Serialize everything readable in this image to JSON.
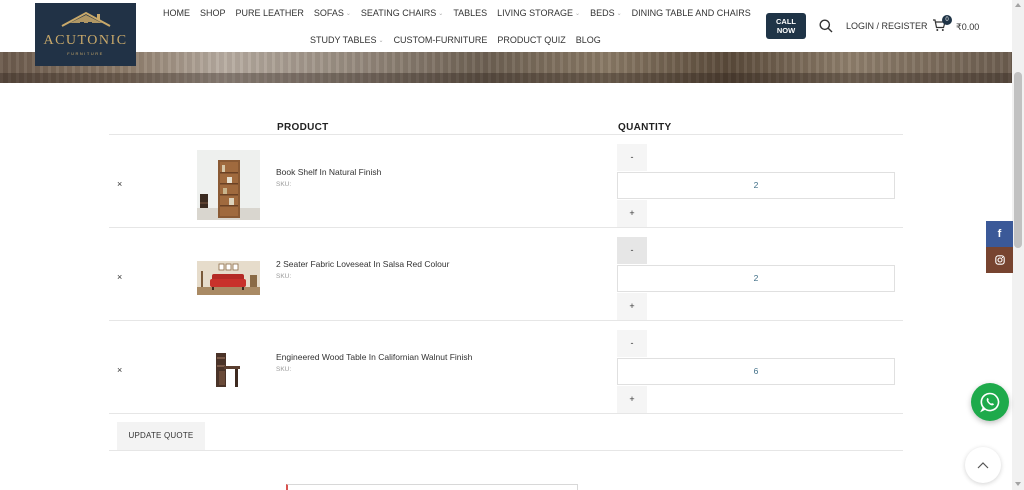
{
  "header": {
    "logo_name": "ACUTONIC",
    "logo_sub": "FURNITURE",
    "nav_row1": [
      {
        "label": "Home",
        "caret": false
      },
      {
        "label": "Shop",
        "caret": false
      },
      {
        "label": "Pure Leather",
        "caret": false
      },
      {
        "label": "Sofas",
        "caret": true
      },
      {
        "label": "Seating Chairs",
        "caret": true
      },
      {
        "label": "Tables",
        "caret": false
      },
      {
        "label": "Living Storage",
        "caret": true
      },
      {
        "label": "Beds",
        "caret": true
      },
      {
        "label": "Dining Table and Chairs",
        "caret": false
      }
    ],
    "nav_row2": [
      {
        "label": "Study Tables",
        "caret": true
      },
      {
        "label": "Custom-Furniture",
        "caret": false
      },
      {
        "label": "Product Quiz",
        "caret": false
      },
      {
        "label": "Blog",
        "caret": false
      }
    ],
    "call_line1": "CALL",
    "call_line2": "NOW",
    "login_label": "LOGIN / REGISTER",
    "cart_count": "0",
    "cart_total": "₹0.00"
  },
  "table": {
    "col_product": "PRODUCT",
    "col_quantity": "QUANTITY",
    "remove_symbol": "×",
    "minus_label": "-",
    "plus_label": "+",
    "rows": [
      {
        "name": "Book Shelf In Natural Finish",
        "sku": "SKU:",
        "qty": "2",
        "thumb": "bookshelf"
      },
      {
        "name": "2 Seater Fabric Loveseat In Salsa Red Colour",
        "sku": "SKU:",
        "qty": "2",
        "thumb": "loveseat"
      },
      {
        "name": "Engineered Wood Table In Californian Walnut Finish",
        "sku": "SKU:",
        "qty": "6",
        "thumb": "study-table"
      }
    ]
  },
  "update_label": "UPDATE QUOTE",
  "social": {
    "facebook_icon": "facebook-icon",
    "instagram_icon": "instagram-icon",
    "whatsapp_icon": "whatsapp-icon",
    "back_to_top_icon": "chevron-up-icon"
  },
  "colors": {
    "brand_navy": "#213246",
    "facebook": "#3b5998",
    "instagram": "#774430",
    "whatsapp": "#1eaa4b",
    "qty_text": "#3f6e87"
  }
}
